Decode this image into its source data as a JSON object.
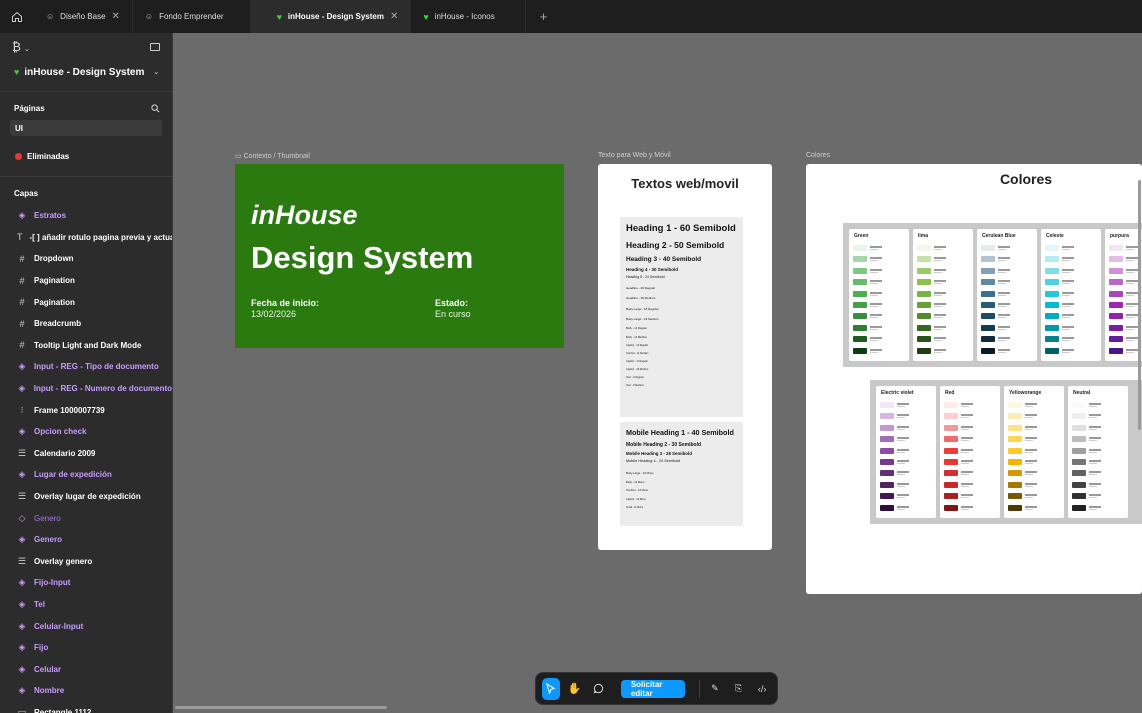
{
  "tabs": [
    {
      "label": "Diseño Base",
      "icon": "smiley-icon",
      "active": false,
      "closable": true
    },
    {
      "label": "Fondo Emprender",
      "icon": "smiley-icon",
      "active": false,
      "closable": false
    },
    {
      "label": "inHouse - Design System",
      "icon": "heart-icon",
      "active": true,
      "closable": true
    },
    {
      "label": "inHouse - Iconos",
      "icon": "heart-icon",
      "active": false,
      "closable": false
    }
  ],
  "tab_close_glyph": "✕",
  "tab_add_glyph": "+",
  "sidebar": {
    "file_name": "inHouse - Design System",
    "pages_title": "Páginas",
    "pages": [
      {
        "label": "UI",
        "selected": true
      },
      {
        "label": "Eliminadas",
        "selected": false,
        "dot": "#e53935"
      }
    ],
    "layers_title": "Capas",
    "layers": [
      {
        "label": "Estratos",
        "type": "component"
      },
      {
        "label": "-[ ] añadir rotulo pagina previa y actua",
        "type": "text"
      },
      {
        "label": "Dropdown",
        "type": "frame"
      },
      {
        "label": "Pagination",
        "type": "frame"
      },
      {
        "label": "Pagination",
        "type": "frame"
      },
      {
        "label": "Breadcrumb",
        "type": "frame"
      },
      {
        "label": "Tooltip Light and Dark Mode",
        "type": "frame"
      },
      {
        "label": "Input - REG - Tipo de documento",
        "type": "component"
      },
      {
        "label": "Input - REG - Numero de documento",
        "type": "component"
      },
      {
        "label": "Frame 1000007739",
        "type": "autolayout"
      },
      {
        "label": "Opcion check",
        "type": "component"
      },
      {
        "label": "Calendario 2009",
        "type": "list"
      },
      {
        "label": "Lugar de expedición",
        "type": "component"
      },
      {
        "label": "Overlay lugar de expedición",
        "type": "list"
      },
      {
        "label": "Genero",
        "type": "instance"
      },
      {
        "label": "Genero",
        "type": "component"
      },
      {
        "label": "Overlay genero",
        "type": "list"
      },
      {
        "label": "Fijo-Input",
        "type": "component"
      },
      {
        "label": "Tel",
        "type": "component"
      },
      {
        "label": "Celular-Input",
        "type": "component"
      },
      {
        "label": "Fijo",
        "type": "component"
      },
      {
        "label": "Celular",
        "type": "component"
      },
      {
        "label": "Nombre",
        "type": "component"
      },
      {
        "label": "Rectangle 1112",
        "type": "rect"
      }
    ]
  },
  "frames": {
    "thumbnail_label": "Contexto / Thumbnail",
    "texts_label": "Texto para Web y Móvil",
    "colors_label": "Colores"
  },
  "thumbnail": {
    "title_1": "inHouse",
    "title_2": "Design System",
    "start_label": "Fecha de inicio:",
    "start_value": "13/02/2026",
    "status_label": "Estado:",
    "status_value": "En curso",
    "bg": "#2a7a10"
  },
  "texts": {
    "title": "Textos web/movil",
    "web": [
      {
        "t": "Heading 1 - 60 Semibold",
        "s": 9.5
      },
      {
        "t": "Heading 2 - 50 Semibold",
        "s": 8.5
      },
      {
        "t": "Heading 3 - 40 Semibold",
        "s": 6.5
      },
      {
        "t": "Heading 4 - 30 Semibold",
        "s": 4.5
      },
      {
        "t": "Heading 5 - 24 Semibold",
        "s": 3.5
      },
      {
        "t": "Headline - 20 Regular",
        "s": 3
      },
      {
        "t": "Headline - 18 Medium",
        "s": 3
      },
      {
        "t": "Body Large - 18 Regular",
        "s": 3
      },
      {
        "t": "Body Large - 16 Medium",
        "s": 3
      },
      {
        "t": "Body - 14 Regular",
        "s": 2.6
      },
      {
        "t": "Body - 14 Medium",
        "s": 2.6
      },
      {
        "t": "Caption - 12 Regular",
        "s": 2.4
      },
      {
        "t": "Overline - 11 Medium",
        "s": 2.4
      },
      {
        "t": "Caption - 11 Regular",
        "s": 2.4
      },
      {
        "t": "Caption - 10 Medium",
        "s": 2.4
      },
      {
        "t": "Over - 9 Regular",
        "s": 2.4
      },
      {
        "t": "Over - 8 Medium",
        "s": 2.4
      }
    ],
    "mobile": [
      {
        "t": "Mobile Heading 1 - 40 Semibold",
        "s": 7.2
      },
      {
        "t": "Mobile Heading 2 - 30 Semibold",
        "s": 5
      },
      {
        "t": "Mobile Heading 3 - 28 Semibold",
        "s": 4.4
      },
      {
        "t": "Mobile Heading 4 - 24 Semibold",
        "s": 3.8
      },
      {
        "t": "Body Large - 16 Mono",
        "s": 2.8
      },
      {
        "t": "Body - 14 Mono",
        "s": 2.6
      },
      {
        "t": "Overline - 14 Mono",
        "s": 2.6
      },
      {
        "t": "Caption - 12 Mono",
        "s": 2.4
      },
      {
        "t": "Small - 11 Mono",
        "s": 2.4
      }
    ]
  },
  "colors": {
    "title": "Colores",
    "palettes_row1": [
      {
        "name": "Green",
        "shades": [
          "#e8f5e9",
          "#a5d6a7",
          "#81c784",
          "#66bb6a",
          "#4caf50",
          "#43a047",
          "#388e3c",
          "#2e7d32",
          "#1b5e20",
          "#0d3d12"
        ]
      },
      {
        "name": "lima",
        "shades": [
          "#f1f8e9",
          "#c5e1a5",
          "#9ccc65",
          "#8bc34a",
          "#7cb342",
          "#689f38",
          "#558b2f",
          "#33691e",
          "#2a5417",
          "#1e3d10"
        ]
      },
      {
        "name": "Cerulean Blue",
        "shades": [
          "#e3eaf0",
          "#b0c4d4",
          "#7fa0b8",
          "#5c8aa6",
          "#3d6f8f",
          "#2b5a78",
          "#1f4a66",
          "#163a52",
          "#0f2b3e",
          "#081c2a"
        ]
      },
      {
        "name": "Celeste",
        "shades": [
          "#e0f7fa",
          "#b2ebf2",
          "#80deea",
          "#4dd0e1",
          "#26c6da",
          "#00bcd4",
          "#00acc1",
          "#0097a7",
          "#00838f",
          "#006064"
        ]
      },
      {
        "name": "purpura",
        "shades": [
          "#f3e5f5",
          "#e1bee7",
          "#ce93d8",
          "#ba68c8",
          "#ab47bc",
          "#9c27b0",
          "#8e24aa",
          "#7b1fa2",
          "#6a1b9a",
          "#4a148c"
        ]
      }
    ],
    "palettes_row2": [
      {
        "name": "Electric violet",
        "shades": [
          "#f3e5f5",
          "#d7b8e0",
          "#c09ad0",
          "#a36cb8",
          "#8e4aa6",
          "#763890",
          "#632c7a",
          "#512264",
          "#3f1850",
          "#2c0f3a"
        ]
      },
      {
        "name": "Red",
        "shades": [
          "#ffebee",
          "#ffcdd2",
          "#ef9a9a",
          "#f06a6a",
          "#ef3b3b",
          "#e53935",
          "#d32f2f",
          "#c62828",
          "#a81f1f",
          "#7f1515"
        ]
      },
      {
        "name": "Yelloworange",
        "shades": [
          "#fff8e1",
          "#ffecb3",
          "#ffe082",
          "#ffd54f",
          "#ffca28",
          "#f5b400",
          "#d69a00",
          "#a67800",
          "#7a5800",
          "#4d3800"
        ]
      },
      {
        "name": "Neutral",
        "shades": [
          "#fafafa",
          "#eeeeee",
          "#e0e0e0",
          "#bdbdbd",
          "#9e9e9e",
          "#757575",
          "#616161",
          "#424242",
          "#303030",
          "#212121"
        ]
      }
    ]
  },
  "toolbar": {
    "request_label": "Solicitar editar"
  }
}
